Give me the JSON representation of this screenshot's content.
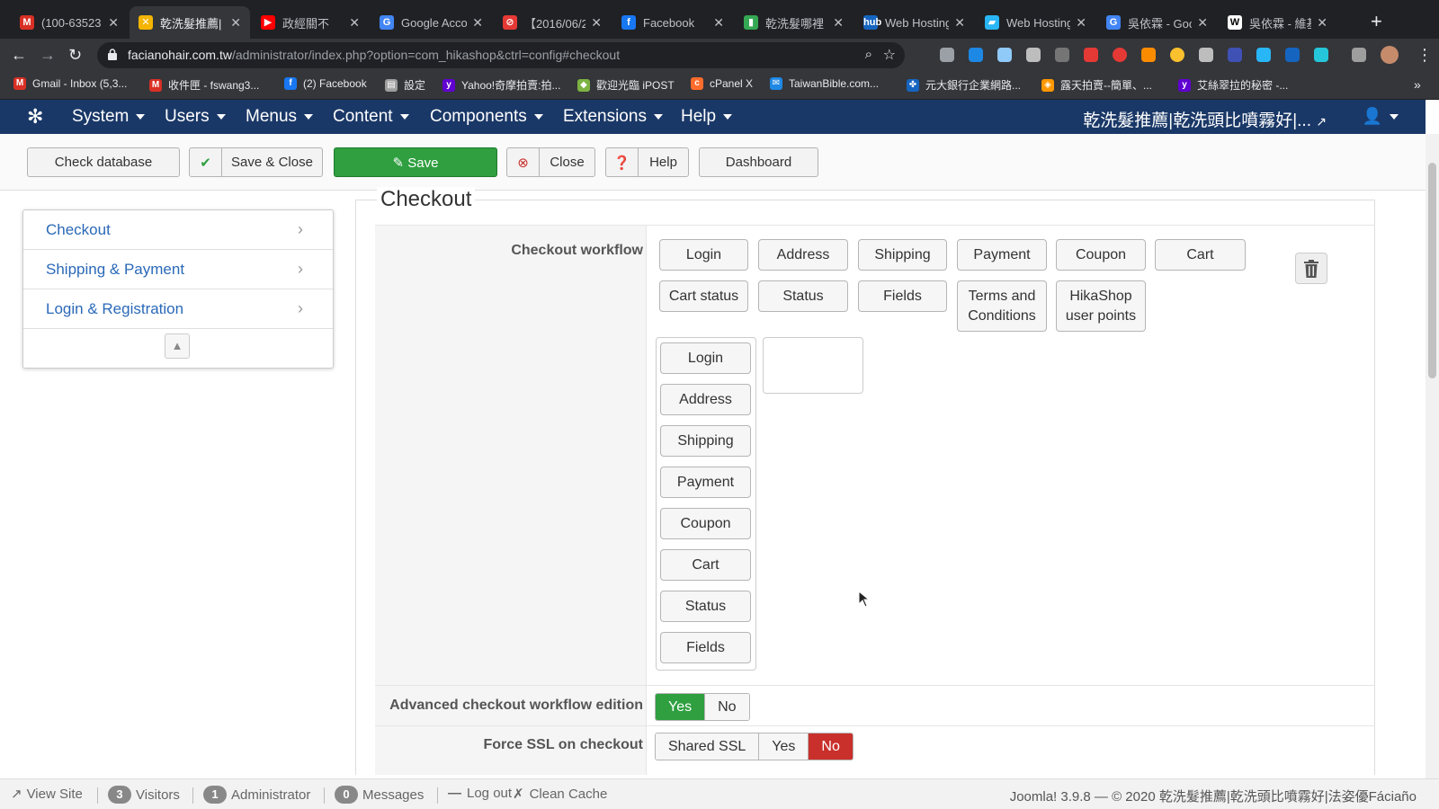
{
  "browser": {
    "tabs": [
      {
        "title": "(100-63523",
        "fav_color": "#d93025",
        "fav": "M",
        "active": false
      },
      {
        "title": "乾洗髮推薦|",
        "fav_color": "#f4b400",
        "fav": "✕",
        "active": true
      },
      {
        "title": "政經關不",
        "fav_color": "#ff0000",
        "fav": "▶",
        "active": false
      },
      {
        "title": "Google Acco",
        "fav_color": "#4285f4",
        "fav": "G",
        "active": false
      },
      {
        "title": "【2016/06/2",
        "fav_color": "#e53935",
        "fav": "⊘",
        "active": false
      },
      {
        "title": "Facebook",
        "fav_color": "#1877f2",
        "fav": "f",
        "active": false
      },
      {
        "title": "乾洗髮哪裡",
        "fav_color": "#34a853",
        "fav": "▮",
        "active": false
      },
      {
        "title": "Web Hosting",
        "fav_color": "#1565c0",
        "fav": "hub",
        "active": false
      },
      {
        "title": "Web Hosting",
        "fav_color": "#29b6f6",
        "fav": "▰",
        "active": false
      },
      {
        "title": "吳依霖 - Goo",
        "fav_color": "#4285f4",
        "fav": "G",
        "active": false
      },
      {
        "title": "吳依霖 - 維基",
        "fav_color": "#ffffff",
        "fav": "W",
        "active": false
      }
    ],
    "new_tab": "+",
    "url_host": "facianohair.com.tw",
    "url_path": "/administrator/index.php?option=com_hikashop&ctrl=config#checkout",
    "bookmarks": [
      {
        "label": "Gmail - Inbox (5,3...",
        "color": "#d93025",
        "icon": "M"
      },
      {
        "label": "收件匣 - fswang3...",
        "color": "#d93025",
        "icon": "M"
      },
      {
        "label": "(2) Facebook",
        "color": "#1877f2",
        "icon": "f"
      },
      {
        "label": "設定",
        "color": "#9e9e9e",
        "icon": "▤"
      },
      {
        "label": "Yahoo!奇摩拍賣:拍...",
        "color": "#6001d2",
        "icon": "y"
      },
      {
        "label": "歡迎光臨 iPOST",
        "color": "#7cb342",
        "icon": "◆"
      },
      {
        "label": "cPanel X",
        "color": "#ff6c2c",
        "icon": "c"
      },
      {
        "label": "TaiwanBible.com...",
        "color": "#1e88e5",
        "icon": "✉"
      },
      {
        "label": "元大銀行企業網路...",
        "color": "#1565c0",
        "icon": "✤"
      },
      {
        "label": "露天拍賣--簡單、...",
        "color": "#ff9800",
        "icon": "◈"
      },
      {
        "label": "艾絲翠拉的秘密 -...",
        "color": "#6001d2",
        "icon": "y"
      }
    ],
    "bookmarks_more": "»"
  },
  "joomla": {
    "menu": [
      "System",
      "Users",
      "Menus",
      "Content",
      "Components",
      "Extensions",
      "Help"
    ],
    "site_name": "乾洗髮推薦|乾洗頭比噴霧好|...",
    "toolbar": {
      "check_db": "Check database",
      "save_close": "Save & Close",
      "save": "Save",
      "close": "Close",
      "help": "Help",
      "dashboard": "Dashboard"
    }
  },
  "sidenav": {
    "items": [
      "Checkout",
      "Shipping & Payment",
      "Login & Registration"
    ]
  },
  "section": {
    "title": "Checkout",
    "workflow_label": "Checkout workflow",
    "available_blocks": [
      "Login",
      "Address",
      "Shipping",
      "Payment",
      "Coupon",
      "Cart",
      "Cart status",
      "Status",
      "Fields",
      "Terms and Conditions",
      "HikaShop user points"
    ],
    "column_blocks": [
      "Login",
      "Address",
      "Shipping",
      "Payment",
      "Coupon",
      "Cart",
      "Status",
      "Fields"
    ],
    "advanced_label": "Advanced checkout workflow edition",
    "advanced_options": [
      "Yes",
      "No"
    ],
    "advanced_selected": "Yes",
    "ssl_label": "Force SSL on checkout",
    "ssl_options": [
      "Shared SSL",
      "Yes",
      "No"
    ],
    "ssl_selected": "No"
  },
  "statusbar": {
    "view_site": "View Site",
    "visitors_count": "3",
    "visitors": "Visitors",
    "admin_count": "1",
    "admin": "Administrator",
    "messages_count": "0",
    "messages": "Messages",
    "logout": "Log out",
    "clean_cache": "Clean Cache",
    "copyright": "Joomla! 3.9.8 — © 2020 乾洗髮推薦|乾洗頭比噴霧好|法姿優Fáciaño"
  },
  "colors": {
    "joomla_nav": "#1a3867",
    "save_green": "#2f9f40",
    "active_red": "#c9302c",
    "link_blue": "#2a69b8"
  }
}
